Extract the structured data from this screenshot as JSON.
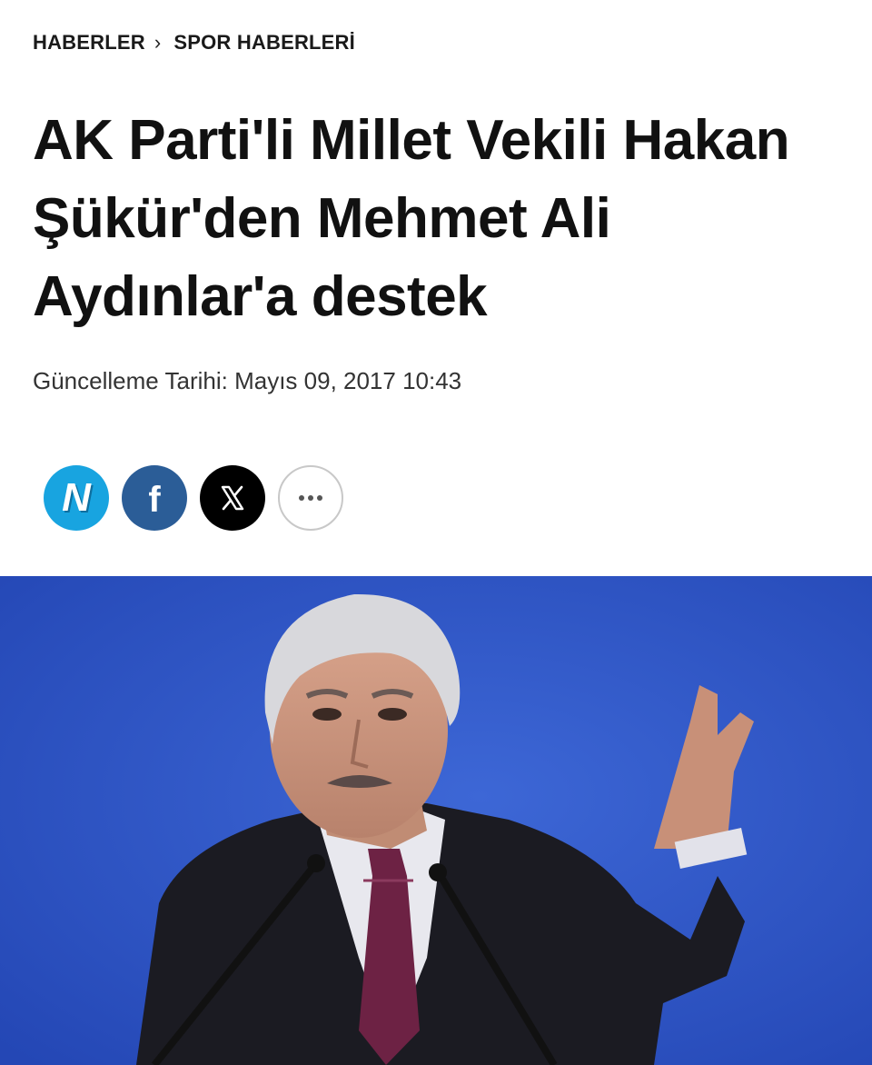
{
  "breadcrumb": {
    "items": [
      "HABERLER",
      "SPOR HABERLERİ"
    ],
    "separator": "›"
  },
  "article": {
    "title": "AK Parti'li Millet Vekili Hakan Şükür'den Mehmet Ali Aydınlar'a destek",
    "updated_label": "Güncelleme Tarihi:",
    "updated_value": "Mayıs 09, 2017 10:43"
  },
  "share": {
    "buttons": [
      {
        "icon": "news-n-icon",
        "glyph": "N",
        "color": "#18a4e0"
      },
      {
        "icon": "facebook-icon",
        "glyph": "f",
        "color": "#2b5d97"
      },
      {
        "icon": "x-twitter-icon",
        "color": "#000000"
      },
      {
        "icon": "more-icon",
        "color": "#ffffff"
      }
    ]
  },
  "hero": {
    "description_icon": "article-photo",
    "background_color": "#2f57c9"
  }
}
